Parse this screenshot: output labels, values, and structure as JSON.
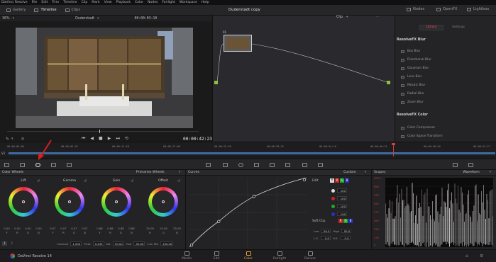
{
  "menu": [
    "DaVinci Resolve",
    "File",
    "Edit",
    "Trim",
    "Timeline",
    "Clip",
    "Mark",
    "View",
    "Playback",
    "Color",
    "Nodes",
    "Fairlight",
    "Workspace",
    "Help"
  ],
  "topbar": {
    "gallery": "Gallery",
    "timeline": "Timeline",
    "clips": "Clips",
    "project_title": "Duderstadt copy",
    "nodes": "Nodes",
    "openfx": "OpenFX",
    "lightbox": "Lightbox"
  },
  "viewer": {
    "zoom": "36%",
    "clip_name": "Duderstadt",
    "timecode_top": "00:00:03:10",
    "timecode_main": "00:00:42:23"
  },
  "nodes_panel": {
    "mode": "Clip",
    "node_number": "01"
  },
  "library": {
    "tabs": [
      "Library",
      "Settings"
    ],
    "section_blur": "ResolveFX Blur",
    "blur_items": [
      "Box Blur",
      "Directional Blur",
      "Gaussian Blur",
      "Lens Blur",
      "Mosaic Blur",
      "Radial Blur",
      "Zoom Blur"
    ],
    "section_color": "ResolveFX Color",
    "color_items": [
      "Color Compressor",
      "Color Space Transform"
    ]
  },
  "timeline": {
    "track": "V1",
    "ticks": [
      "00:00:00:00",
      "00:00:05:25",
      "00:00:11:18",
      "00:00:17:08",
      "00:00:22:20",
      "00:00:28:15",
      "00:00:34:10",
      "00:00:40:21",
      "00:00:46:04",
      "00:00:51:27"
    ]
  },
  "color_wheels": {
    "title": "Color Wheels",
    "mode": "Primaries Wheels",
    "wheels": [
      {
        "name": "Lift",
        "vals": [
          "0.00",
          "0.00",
          "0.00",
          "0.00"
        ]
      },
      {
        "name": "Gamma",
        "vals": [
          "0.07",
          "0.07",
          "0.07",
          "0.07"
        ]
      },
      {
        "name": "Gain",
        "vals": [
          "0.88",
          "0.88",
          "0.88",
          "0.88"
        ]
      },
      {
        "name": "Offset",
        "vals": [
          "25.00",
          "25.00",
          "25.00"
        ]
      }
    ],
    "channels4": [
      "Y",
      "R",
      "G",
      "B"
    ],
    "channels3": [
      "R",
      "G",
      "B"
    ],
    "pages": [
      "1",
      "2"
    ],
    "bottom": {
      "contrast_label": "Contrast",
      "contrast": "1.000",
      "pivot_label": "Pivot",
      "pivot": "0.435",
      "sat_label": "Sat",
      "sat": "50.00",
      "hue_label": "Hue",
      "hue": "50.00",
      "lummix_label": "Lum Mix",
      "lummix": "100.00"
    }
  },
  "curves": {
    "title": "Curves",
    "mode": "Custom",
    "edit_label": "Edit",
    "channels": [
      "Y",
      "R",
      "G",
      "B"
    ],
    "values": [
      "100",
      "100",
      "100",
      "100"
    ],
    "softclip_label": "Soft Clip",
    "low_label": "Low",
    "low": "50.0",
    "high_label": "High",
    "high": "50.0",
    "ls_label": "L.S.",
    "ls": "0.0",
    "hs_label": "H.S.",
    "hs": "0.0",
    "points": [
      [
        0,
        0
      ],
      [
        0.25,
        0.37
      ],
      [
        0.55,
        0.73
      ],
      [
        1,
        1
      ]
    ]
  },
  "scopes": {
    "title": "Scopes",
    "mode": "Waveform",
    "ylabels": [
      "1023",
      "896",
      "768",
      "640",
      "512",
      "384",
      "256",
      "128",
      "0"
    ]
  },
  "bottom_nav": {
    "app": "DaVinci Resolve 14",
    "pages": [
      "Media",
      "Edit",
      "Color",
      "Fairlight",
      "Deliver"
    ],
    "active": "Color"
  },
  "colors": {
    "accent": "#e5a040",
    "playhead": "#d23c3c",
    "annotation": "#d91e1e"
  }
}
